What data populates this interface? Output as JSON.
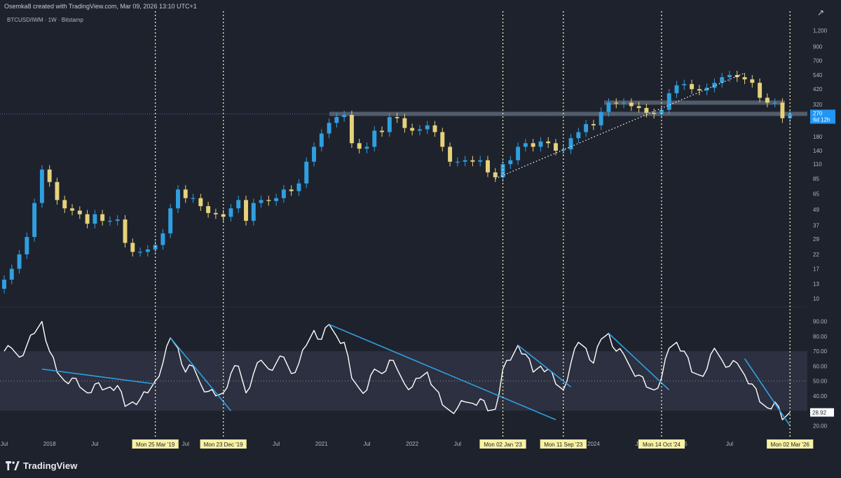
{
  "header": {
    "created_by": "Osemka8 created with TradingView.com, Mar 09, 2026 13:10 UTC+1",
    "share_icon": "share-icon"
  },
  "symbol": {
    "title": "BTCUSD/IWM · 1W · Bitstamp"
  },
  "logo": {
    "text": "TradingView",
    "icon": "tradingview-logo-icon"
  },
  "colors": {
    "background": "#1e222d",
    "up_candle": "#2f9fe0",
    "down_candle": "#e6d27a",
    "white_line": "#ffffff",
    "trend_line": "#2f9fe0",
    "date_marker": "#f5f0a0",
    "date_label_bg": "#f7f1a4",
    "price_label_bg": "#2196f3"
  },
  "chart_data": [
    {
      "type": "candlestick",
      "title": "BTCUSD/IWM · 1W · Bitstamp",
      "y_scale": "log",
      "y_ticks": [
        "1,200",
        "900",
        "700",
        "540",
        "420",
        "320",
        "270",
        "180",
        "140",
        "110",
        "85",
        "65",
        "49",
        "37",
        "29",
        "22",
        "17",
        "13",
        "10"
      ],
      "last_price": "270",
      "last_price_countdown": "6d 12h",
      "series": [
        {
          "name": "BTCUSD/IWM",
          "points": [
            [
              "2017-07",
              14
            ],
            [
              "2017-08",
              17
            ],
            [
              "2017-09",
              22
            ],
            [
              "2017-10",
              30
            ],
            [
              "2017-11",
              55
            ],
            [
              "2017-12",
              100
            ],
            [
              "2018-01",
              80
            ],
            [
              "2018-02",
              58
            ],
            [
              "2018-03",
              50
            ],
            [
              "2018-04",
              48
            ],
            [
              "2018-05",
              45
            ],
            [
              "2018-06",
              38
            ],
            [
              "2018-07",
              45
            ],
            [
              "2018-08",
              40
            ],
            [
              "2018-09",
              40
            ],
            [
              "2018-10",
              41
            ],
            [
              "2018-11",
              27
            ],
            [
              "2018-12",
              23
            ],
            [
              "2019-01",
              23
            ],
            [
              "2019-02",
              24
            ],
            [
              "2019-03",
              26
            ],
            [
              "2019-04",
              32
            ],
            [
              "2019-05",
              50
            ],
            [
              "2019-06",
              70
            ],
            [
              "2019-07",
              60
            ],
            [
              "2019-08",
              60
            ],
            [
              "2019-09",
              52
            ],
            [
              "2019-10",
              46
            ],
            [
              "2019-11",
              45
            ],
            [
              "2019-12",
              43
            ],
            [
              "2020-01",
              50
            ],
            [
              "2020-02",
              58
            ],
            [
              "2020-03",
              40
            ],
            [
              "2020-04",
              55
            ],
            [
              "2020-05",
              58
            ],
            [
              "2020-06",
              57
            ],
            [
              "2020-07",
              60
            ],
            [
              "2020-08",
              70
            ],
            [
              "2020-09",
              68
            ],
            [
              "2020-10",
              78
            ],
            [
              "2020-11",
              115
            ],
            [
              "2020-12",
              150
            ],
            [
              "2021-01",
              190
            ],
            [
              "2021-02",
              230
            ],
            [
              "2021-03",
              255
            ],
            [
              "2021-04",
              265
            ],
            [
              "2021-05",
              160
            ],
            [
              "2021-06",
              145
            ],
            [
              "2021-07",
              150
            ],
            [
              "2021-08",
              200
            ],
            [
              "2021-09",
              195
            ],
            [
              "2021-10",
              255
            ],
            [
              "2021-11",
              250
            ],
            [
              "2021-12",
              210
            ],
            [
              "2022-01",
              200
            ],
            [
              "2022-02",
              205
            ],
            [
              "2022-03",
              220
            ],
            [
              "2022-04",
              195
            ],
            [
              "2022-05",
              150
            ],
            [
              "2022-06",
              115
            ],
            [
              "2022-07",
              115
            ],
            [
              "2022-08",
              118
            ],
            [
              "2022-09",
              115
            ],
            [
              "2022-10",
              118
            ],
            [
              "2022-11",
              95
            ],
            [
              "2022-12",
              87
            ],
            [
              "2023-01",
              110
            ],
            [
              "2023-02",
              118
            ],
            [
              "2023-03",
              150
            ],
            [
              "2023-04",
              160
            ],
            [
              "2023-05",
              150
            ],
            [
              "2023-06",
              165
            ],
            [
              "2023-07",
              160
            ],
            [
              "2023-08",
              140
            ],
            [
              "2023-09",
              143
            ],
            [
              "2023-10",
              175
            ],
            [
              "2023-11",
              195
            ],
            [
              "2023-12",
              225
            ],
            [
              "2024-01",
              220
            ],
            [
              "2024-02",
              280
            ],
            [
              "2024-03",
              330
            ],
            [
              "2024-04",
              325
            ],
            [
              "2024-05",
              330
            ],
            [
              "2024-06",
              310
            ],
            [
              "2024-07",
              300
            ],
            [
              "2024-08",
              275
            ],
            [
              "2024-09",
              270
            ],
            [
              "2024-10",
              290
            ],
            [
              "2024-11",
              390
            ],
            [
              "2024-12",
              450
            ],
            [
              "2025-01",
              460
            ],
            [
              "2025-02",
              420
            ],
            [
              "2025-03",
              410
            ],
            [
              "2025-04",
              430
            ],
            [
              "2025-05",
              470
            ],
            [
              "2025-06",
              520
            ],
            [
              "2025-07",
              540
            ],
            [
              "2025-08",
              520
            ],
            [
              "2025-09",
              500
            ],
            [
              "2025-10",
              470
            ],
            [
              "2025-11",
              360
            ],
            [
              "2025-12",
              330
            ],
            [
              "2026-01",
              330
            ],
            [
              "2026-02",
              250
            ],
            [
              "2026-03",
              270
            ]
          ]
        }
      ],
      "horizontal_levels": [
        270,
        330
      ],
      "trendline": {
        "from": [
          "2022-12",
          85
        ],
        "to": [
          "2025-09",
          560
        ],
        "style": "dotted"
      }
    },
    {
      "type": "line",
      "title": "",
      "y_ticks": [
        "90.00",
        "80.00",
        "70.00",
        "60.00",
        "50.00",
        "40.00",
        "30.00",
        "20.00"
      ],
      "ylim": [
        15,
        95
      ],
      "band": [
        30,
        70
      ],
      "midline": 50,
      "last_value": "28.92",
      "series": [
        {
          "name": "",
          "points": [
            [
              "2017-07",
              70
            ],
            [
              "2017-08",
              72
            ],
            [
              "2017-09",
              66
            ],
            [
              "2017-10",
              74
            ],
            [
              "2017-11",
              82
            ],
            [
              "2017-12",
              90
            ],
            [
              "2018-01",
              70
            ],
            [
              "2018-02",
              56
            ],
            [
              "2018-03",
              50
            ],
            [
              "2018-04",
              52
            ],
            [
              "2018-05",
              46
            ],
            [
              "2018-06",
              42
            ],
            [
              "2018-07",
              48
            ],
            [
              "2018-08",
              44
            ],
            [
              "2018-09",
              46
            ],
            [
              "2018-10",
              47
            ],
            [
              "2018-11",
              33
            ],
            [
              "2018-12",
              36
            ],
            [
              "2019-01",
              38
            ],
            [
              "2019-02",
              42
            ],
            [
              "2019-03",
              50
            ],
            [
              "2019-04",
              62
            ],
            [
              "2019-05",
              79
            ],
            [
              "2019-06",
              72
            ],
            [
              "2019-07",
              56
            ],
            [
              "2019-08",
              60
            ],
            [
              "2019-09",
              48
            ],
            [
              "2019-10",
              43
            ],
            [
              "2019-11",
              40
            ],
            [
              "2019-12",
              42
            ],
            [
              "2020-01",
              55
            ],
            [
              "2020-02",
              60
            ],
            [
              "2020-03",
              42
            ],
            [
              "2020-04",
              55
            ],
            [
              "2020-05",
              64
            ],
            [
              "2020-06",
              58
            ],
            [
              "2020-07",
              62
            ],
            [
              "2020-08",
              66
            ],
            [
              "2020-09",
              55
            ],
            [
              "2020-10",
              62
            ],
            [
              "2020-11",
              74
            ],
            [
              "2020-12",
              84
            ],
            [
              "2021-01",
              78
            ],
            [
              "2021-02",
              88
            ],
            [
              "2021-03",
              80
            ],
            [
              "2021-04",
              76
            ],
            [
              "2021-05",
              52
            ],
            [
              "2021-06",
              45
            ],
            [
              "2021-07",
              44
            ],
            [
              "2021-08",
              58
            ],
            [
              "2021-09",
              55
            ],
            [
              "2021-10",
              64
            ],
            [
              "2021-11",
              58
            ],
            [
              "2021-12",
              48
            ],
            [
              "2022-01",
              46
            ],
            [
              "2022-02",
              52
            ],
            [
              "2022-03",
              56
            ],
            [
              "2022-04",
              45
            ],
            [
              "2022-05",
              34
            ],
            [
              "2022-06",
              30
            ],
            [
              "2022-07",
              32
            ],
            [
              "2022-08",
              36
            ],
            [
              "2022-09",
              35
            ],
            [
              "2022-10",
              38
            ],
            [
              "2022-11",
              30
            ],
            [
              "2022-12",
              31
            ],
            [
              "2023-01",
              58
            ],
            [
              "2023-02",
              64
            ],
            [
              "2023-03",
              74
            ],
            [
              "2023-04",
              68
            ],
            [
              "2023-05",
              56
            ],
            [
              "2023-06",
              60
            ],
            [
              "2023-07",
              58
            ],
            [
              "2023-08",
              48
            ],
            [
              "2023-09",
              44
            ],
            [
              "2023-10",
              62
            ],
            [
              "2023-11",
              76
            ],
            [
              "2023-12",
              72
            ],
            [
              "2024-01",
              62
            ],
            [
              "2024-02",
              78
            ],
            [
              "2024-03",
              82
            ],
            [
              "2024-04",
              70
            ],
            [
              "2024-05",
              68
            ],
            [
              "2024-06",
              58
            ],
            [
              "2024-07",
              54
            ],
            [
              "2024-08",
              46
            ],
            [
              "2024-09",
              44
            ],
            [
              "2024-10",
              52
            ],
            [
              "2024-11",
              72
            ],
            [
              "2024-12",
              76
            ],
            [
              "2025-01",
              70
            ],
            [
              "2025-02",
              56
            ],
            [
              "2025-03",
              54
            ],
            [
              "2025-04",
              58
            ],
            [
              "2025-05",
              72
            ],
            [
              "2025-06",
              64
            ],
            [
              "2025-07",
              60
            ],
            [
              "2025-08",
              62
            ],
            [
              "2025-09",
              54
            ],
            [
              "2025-10",
              48
            ],
            [
              "2025-11",
              36
            ],
            [
              "2025-12",
              32
            ],
            [
              "2026-01",
              36
            ],
            [
              "2026-02",
              24
            ],
            [
              "2026-03",
              28.92
            ]
          ]
        }
      ],
      "trendlines": [
        {
          "from": [
            "2017-12",
            58
          ],
          "to": [
            "2019-03",
            48
          ]
        },
        {
          "from": [
            "2019-05",
            79
          ],
          "to": [
            "2020-01",
            30
          ]
        },
        {
          "from": [
            "2021-02",
            88
          ],
          "to": [
            "2023-08",
            24
          ]
        },
        {
          "from": [
            "2023-03",
            74
          ],
          "to": [
            "2023-10",
            46
          ]
        },
        {
          "from": [
            "2024-03",
            82
          ],
          "to": [
            "2024-11",
            44
          ]
        },
        {
          "from": [
            "2025-09",
            65
          ],
          "to": [
            "2026-03",
            20
          ]
        }
      ]
    }
  ],
  "x_axis": {
    "ticks": [
      "Jul",
      "2018",
      "Jul",
      "2",
      "Jul",
      "Jul",
      "2021",
      "Jul",
      "2022",
      "Jul",
      "Jul",
      "2024",
      "Jul",
      "25",
      "Jul"
    ],
    "date_markers": [
      {
        "date": "2019-03",
        "label": "Mon 25 Mar '19"
      },
      {
        "date": "2019-12",
        "label": "Mon 23 Dec '19"
      },
      {
        "date": "2023-01",
        "label": "Mon 02 Jan '23"
      },
      {
        "date": "2023-09",
        "label": "Mon 11 Sep '23"
      },
      {
        "date": "2024-10",
        "label": "Mon 14 Oct '24"
      },
      {
        "date": "2026-03",
        "label": "Mon 02 Mar '26"
      }
    ]
  }
}
